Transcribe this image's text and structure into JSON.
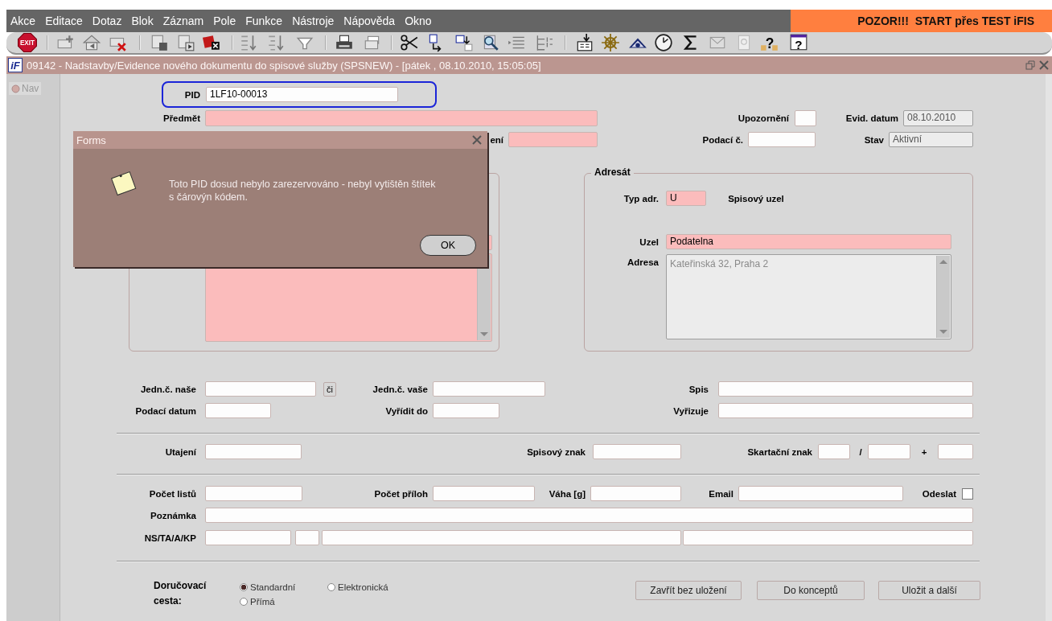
{
  "menu_bar": {
    "items": [
      {
        "label": "Akce"
      },
      {
        "label": "Editace"
      },
      {
        "label": "Dotaz"
      },
      {
        "label": "Blok"
      },
      {
        "label": "Záznam"
      },
      {
        "label": "Pole"
      },
      {
        "label": "Funkce"
      },
      {
        "label": "Nástroje"
      },
      {
        "label": "Nápověda"
      },
      {
        "label": "Okno"
      }
    ],
    "banner": "POZOR!!!  START přes TEST iFIS"
  },
  "toolbar": {
    "exit_text": "EXIT",
    "help_marks": [
      "?",
      "?"
    ]
  },
  "window": {
    "logo": "iF",
    "title": "09142 - Nadstavby/Evidence nového dokumentu do spisové služby (SPSNEW) - [pátek , 08.10.2010, 15:05:05]"
  },
  "navigator": {
    "label": "Nav"
  },
  "form": {
    "pid": {
      "label": "PID",
      "value": "1LF10-00013"
    },
    "rows": [
      {
        "items": [
          {
            "kind": "label",
            "text": "Předmět"
          },
          {
            "kind": "field",
            "required": true,
            "readonly": false
          },
          {
            "kind": "label",
            "text": "Upozornění"
          },
          {
            "kind": "field",
            "required": false,
            "readonly": false
          },
          {
            "kind": "label",
            "text": "Evid. datum"
          },
          {
            "kind": "field",
            "value": "08.10.2010",
            "required": false,
            "readonly": true
          }
        ]
      },
      {
        "items": [
          {
            "kind": "label",
            "text": "ení"
          },
          {
            "kind": "field",
            "required": true,
            "readonly": false
          },
          {
            "kind": "label",
            "text": "Podací č."
          },
          {
            "kind": "field",
            "required": false,
            "readonly": false
          },
          {
            "kind": "label",
            "text": "Stav"
          },
          {
            "kind": "field",
            "value": "Aktivní",
            "required": false,
            "readonly": true
          }
        ]
      },
      {
        "items": [
          {
            "kind": "label",
            "text": "Jedn.č. naše"
          },
          {
            "kind": "field",
            "required": false,
            "readonly": false
          },
          {
            "kind": "button",
            "text": "či"
          },
          {
            "kind": "label",
            "text": "Jedn.č. vaše"
          },
          {
            "kind": "field",
            "required": false,
            "readonly": false
          },
          {
            "kind": "label",
            "text": "Spis"
          },
          {
            "kind": "field",
            "required": false,
            "readonly": false
          }
        ]
      },
      {
        "items": [
          {
            "kind": "label",
            "text": "Podací datum"
          },
          {
            "kind": "field",
            "required": false,
            "readonly": false
          },
          {
            "kind": "label",
            "text": "Vyřídit do"
          },
          {
            "kind": "field",
            "required": false,
            "readonly": false
          },
          {
            "kind": "label",
            "text": "Vyřizuje"
          },
          {
            "kind": "field",
            "required": false,
            "readonly": false
          }
        ]
      },
      {
        "items": [
          {
            "kind": "label",
            "text": "Utajení"
          },
          {
            "kind": "field",
            "required": false,
            "readonly": false
          },
          {
            "kind": "label",
            "text": "Spisový znak"
          },
          {
            "kind": "field",
            "required": false,
            "readonly": false
          },
          {
            "kind": "label",
            "text": "Skartační znak"
          },
          {
            "kind": "field",
            "required": false,
            "readonly": false
          },
          {
            "kind": "text",
            "text": "/"
          },
          {
            "kind": "field",
            "required": false,
            "readonly": false
          },
          {
            "kind": "text",
            "text": "+"
          },
          {
            "kind": "field",
            "required": false,
            "readonly": false
          }
        ]
      },
      {
        "items": [
          {
            "kind": "label",
            "text": "Počet listů"
          },
          {
            "kind": "field",
            "required": false,
            "readonly": false
          },
          {
            "kind": "label",
            "text": "Počet příloh"
          },
          {
            "kind": "field",
            "required": false,
            "readonly": false
          },
          {
            "kind": "label",
            "text": "Váha [g]"
          },
          {
            "kind": "field",
            "required": false,
            "readonly": false
          },
          {
            "kind": "label",
            "text": "Email"
          },
          {
            "kind": "field",
            "required": false,
            "readonly": false
          },
          {
            "kind": "label",
            "text": "Odeslat"
          },
          {
            "kind": "checkbox",
            "checked": false
          }
        ]
      },
      {
        "items": [
          {
            "kind": "label",
            "text": "Poznámka"
          },
          {
            "kind": "field",
            "required": false,
            "readonly": false
          }
        ]
      },
      {
        "items": [
          {
            "kind": "label",
            "text": "NS/TA/A/KP"
          },
          {
            "kind": "field",
            "required": false,
            "readonly": false
          },
          {
            "kind": "field",
            "required": false,
            "readonly": false
          },
          {
            "kind": "field",
            "required": false,
            "readonly": false
          },
          {
            "kind": "field",
            "required": false,
            "readonly": false
          }
        ]
      }
    ],
    "groups": [
      {
        "rows": [
          {
            "items": [
              {
                "kind": "field",
                "required": true,
                "readonly": false
              }
            ]
          },
          {
            "items": [
              {
                "kind": "textarea",
                "required": true,
                "readonly": false
              }
            ]
          }
        ]
      },
      {
        "legend": "Adresát",
        "rows": [
          {
            "items": [
              {
                "kind": "label",
                "text": "Typ adr."
              },
              {
                "kind": "field",
                "value": "U",
                "required": true,
                "readonly": false
              },
              {
                "kind": "text",
                "text": "Spisový uzel"
              }
            ]
          },
          {
            "items": [
              {
                "kind": "label",
                "text": "Uzel"
              },
              {
                "kind": "field",
                "value": "Podatelna",
                "required": true,
                "readonly": false
              }
            ]
          },
          {
            "items": [
              {
                "kind": "label",
                "text": "Adresa"
              },
              {
                "kind": "textarea",
                "value": "Kateřinská 32, Praha 2",
                "required": false,
                "readonly": true
              }
            ]
          }
        ]
      }
    ],
    "delivery": {
      "label": "Doručovací cesta:",
      "options": [
        {
          "label": "Standardní",
          "selected": true
        },
        {
          "label": "Elektronická",
          "selected": false
        },
        {
          "label": "Přímá",
          "selected": false
        }
      ]
    },
    "buttons": [
      "Zavřít bez uložení",
      "Do konceptů",
      "Uložit a další"
    ]
  },
  "dialog": {
    "title": "Forms",
    "message": "Toto PID dosud nebylo zarezervováno - nebyl vytištěn štítek s čárovýn kódem.",
    "button": {
      "label": "OK"
    }
  }
}
